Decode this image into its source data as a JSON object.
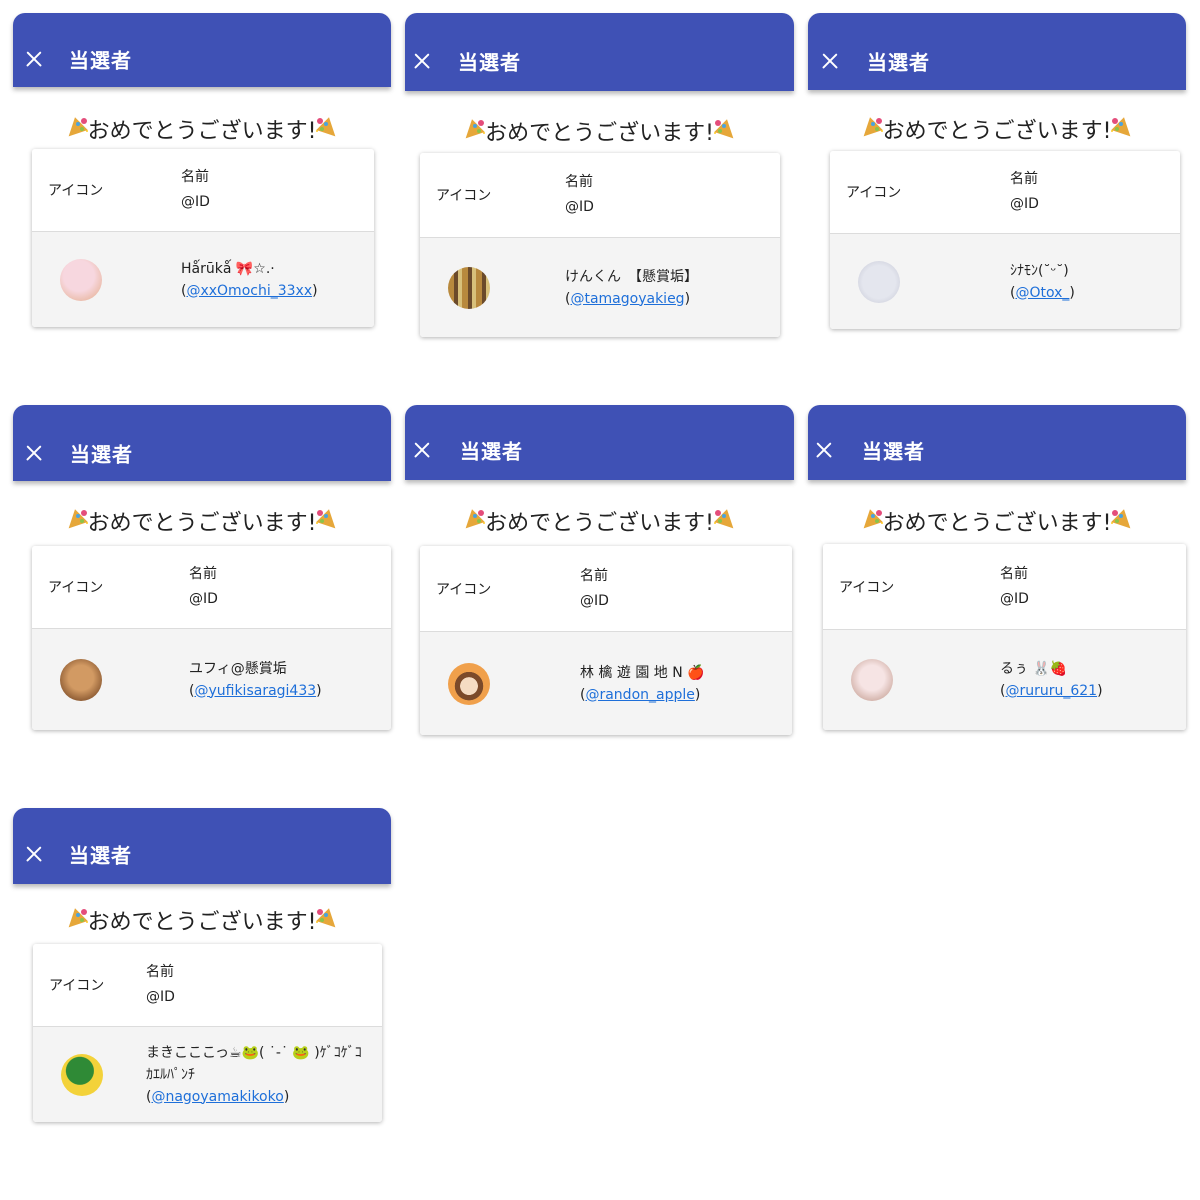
{
  "panels": [
    {
      "title": "当選者",
      "congrats": "おめでとうございます!",
      "col_icon": "アイコン",
      "col_name": "名前",
      "col_id": "@ID",
      "winner_name": "Hǻrūkǻ 🎀☆.·",
      "winner_handle": "@xxOmochi_33xx",
      "avatar_colors": [
        "#f7d7df",
        "#e9b9a4"
      ]
    },
    {
      "title": "当選者",
      "congrats": "おめでとうございます!",
      "col_icon": "アイコン",
      "col_name": "名前",
      "col_id": "@ID",
      "winner_name": "けんくん　【懸賞垢】",
      "winner_handle": "@tamagoyakieg",
      "avatar_colors": [
        "#b8893d",
        "#6b4a2a"
      ]
    },
    {
      "title": "当選者",
      "congrats": "おめでとうございます!",
      "col_icon": "アイコン",
      "col_name": "名前",
      "col_id": "@ID",
      "winner_name": "ｼﾅﾓﾝ(˘ᵕ˘)",
      "winner_handle": "@Otox_",
      "avatar_colors": [
        "#e4e6ee",
        "#c9cbd8"
      ]
    },
    {
      "title": "当選者",
      "congrats": "おめでとうございます!",
      "col_icon": "アイコン",
      "col_name": "名前",
      "col_id": "@ID",
      "winner_name": "ユフィ@懸賞垢",
      "winner_handle": "@yufikisaragi433",
      "avatar_colors": [
        "#d29a63",
        "#7a4a26"
      ]
    },
    {
      "title": "当選者",
      "congrats": "おめでとうございます!",
      "col_icon": "アイコン",
      "col_name": "名前",
      "col_id": "@ID",
      "winner_name": "林 檎 遊 園 地 N 🍎",
      "winner_handle": "@randon_apple",
      "avatar_colors": [
        "#f0a04b",
        "#7b4a2a"
      ]
    },
    {
      "title": "当選者",
      "congrats": "おめでとうございます!",
      "col_icon": "アイコン",
      "col_name": "名前",
      "col_id": "@ID",
      "winner_name": "るぅ 🐰🍓",
      "winner_handle": "@rururu_621",
      "avatar_colors": [
        "#f6e4e4",
        "#c9a59a"
      ]
    },
    {
      "title": "当選者",
      "congrats": "おめでとうございます!",
      "col_icon": "アイコン",
      "col_name": "名前",
      "col_id": "@ID",
      "winner_name": "まきこここっ☕🐸( ˙-˙ 🐸 )ｹﾞｺｹﾞｺ ｶｴﾙﾊﾟﾝﾁ",
      "winner_handle": "@nagoyamakikoko",
      "avatar_colors": [
        "#f3d23a",
        "#2f8a36"
      ]
    }
  ]
}
